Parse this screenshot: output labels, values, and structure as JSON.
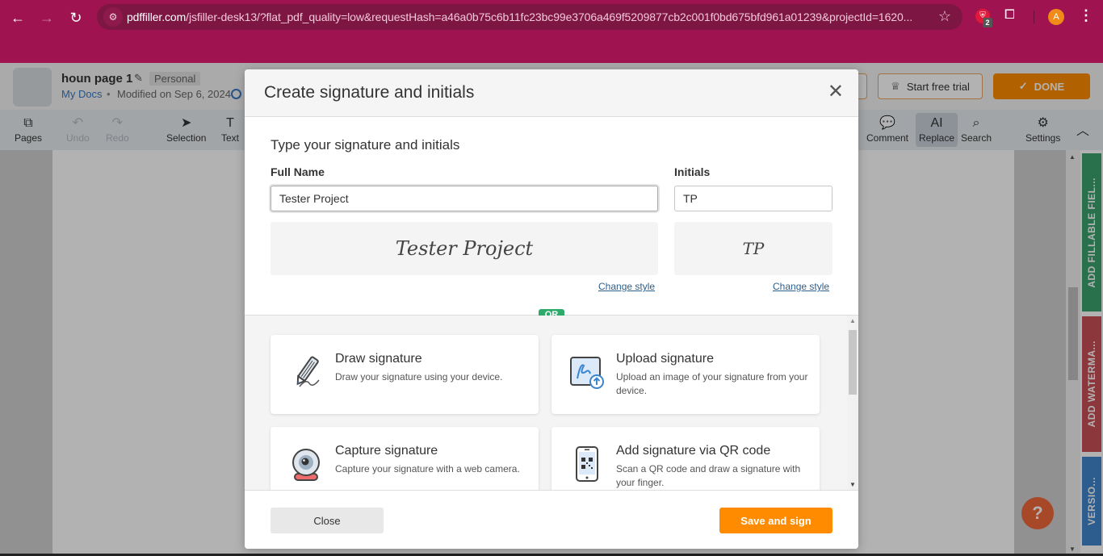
{
  "browser": {
    "url_host": "pdffiller.com",
    "url_rest": "/jsfiller-desk13/?flat_pdf_quality=low&requestHash=a46a0b75c6b11fc23bc99e3706a469f5209877cb2c001f0bd675bfd961a01239&projectId=1620...",
    "extension_badge_count": "2",
    "profile_initial": "A",
    "theme_color": "#9e1350"
  },
  "document": {
    "title": "houn page 1",
    "badge": "Personal",
    "breadcrumb": "My Docs",
    "separator": "•",
    "modified": "Modified on Sep 6, 2024"
  },
  "header_actions": {
    "trial_label": "Start free trial",
    "done_label": "DONE"
  },
  "toolbar": {
    "items": [
      {
        "label": "Pages",
        "icon": "pages-icon",
        "glyph": "⧉"
      },
      {
        "label": "Undo",
        "icon": "undo-icon",
        "glyph": "↶"
      },
      {
        "label": "Redo",
        "icon": "redo-icon",
        "glyph": "↷"
      },
      {
        "label": "Selection",
        "icon": "cursor-icon",
        "glyph": "➤"
      },
      {
        "label": "Text",
        "icon": "text-icon",
        "glyph": "T"
      },
      {
        "label": "Comment",
        "icon": "comment-icon",
        "glyph": "💬"
      },
      {
        "label": "Replace",
        "icon": "replace-icon",
        "glyph": "AI"
      },
      {
        "label": "Search",
        "icon": "search-icon",
        "glyph": "⌕"
      },
      {
        "label": "Settings",
        "icon": "gear-icon",
        "glyph": "⚙"
      }
    ]
  },
  "side_tabs": [
    {
      "label": "ADD FILLABLE FIEL...",
      "color": "#3ca36e"
    },
    {
      "label": "ADD WATERMA...",
      "color": "#c94f56"
    },
    {
      "label": "VERSIO...",
      "color": "#3f86cc"
    }
  ],
  "help_label": "?",
  "modal": {
    "title": "Create signature and initials",
    "section_title": "Type your signature and initials",
    "full_name_label": "Full Name",
    "full_name_value": "Tester Project",
    "initials_label": "Initials",
    "initials_value": "TP",
    "signature_preview": "Tester Project",
    "initials_preview": "TP",
    "change_style_label": "Change style",
    "or_label": "OR",
    "options": [
      {
        "title": "Draw signature",
        "desc": "Draw your signature using your device."
      },
      {
        "title": "Upload signature",
        "desc": "Upload an image of your signature from your device."
      },
      {
        "title": "Capture signature",
        "desc": "Capture your signature with a web camera."
      },
      {
        "title": "Add signature via QR code",
        "desc": "Scan a QR code and draw a signature with your finger."
      }
    ],
    "close_label": "Close",
    "save_label": "Save and sign",
    "accent_color": "#ff8c00",
    "or_color": "#2eab6a"
  }
}
